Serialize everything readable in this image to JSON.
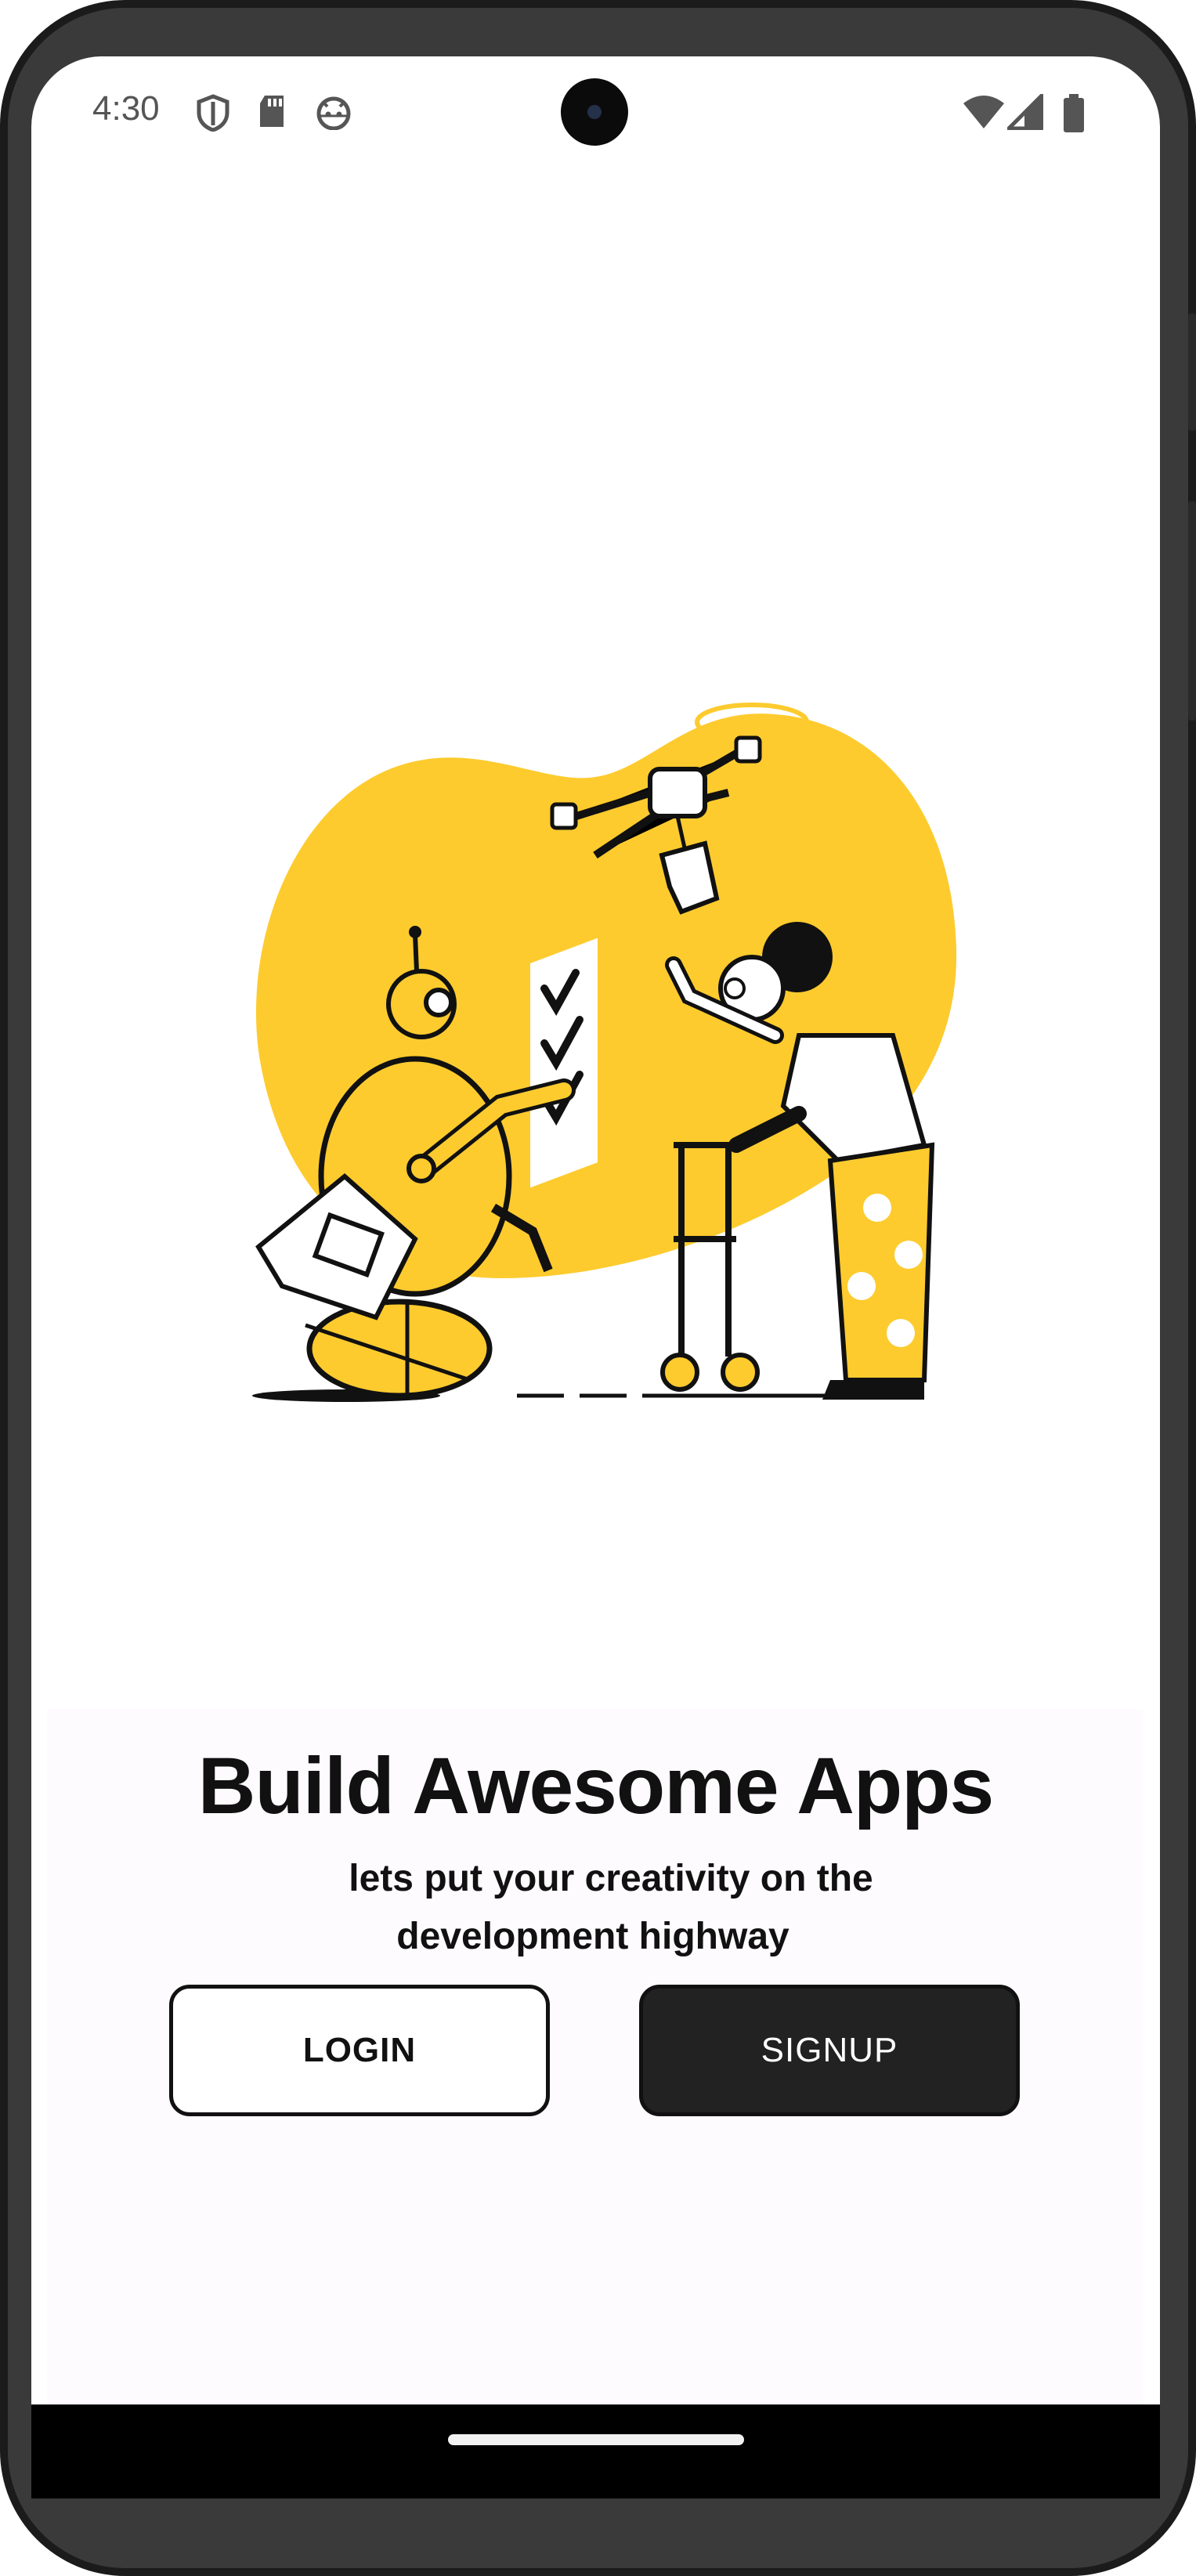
{
  "status_bar": {
    "time": "4:30",
    "left_icons": [
      "shield-icon",
      "sd-card-icon",
      "android-face-icon"
    ],
    "right_icons": [
      "wifi-icon",
      "cellular-signal-icon",
      "battery-icon"
    ]
  },
  "illustration": {
    "description_icon": "robot-drone-checklist-illustration",
    "accent_color": "#FDCB2E"
  },
  "main": {
    "headline": "Build Awesome Apps",
    "subtitle_line1": "lets put your creativity on the",
    "subtitle_line2": "development highway"
  },
  "buttons": {
    "login_label": "LOGIN",
    "signup_label": "SIGNUP"
  },
  "colors": {
    "text": "#111111",
    "signup_bg": "#222222",
    "card_bg": "#FEFBFF"
  }
}
